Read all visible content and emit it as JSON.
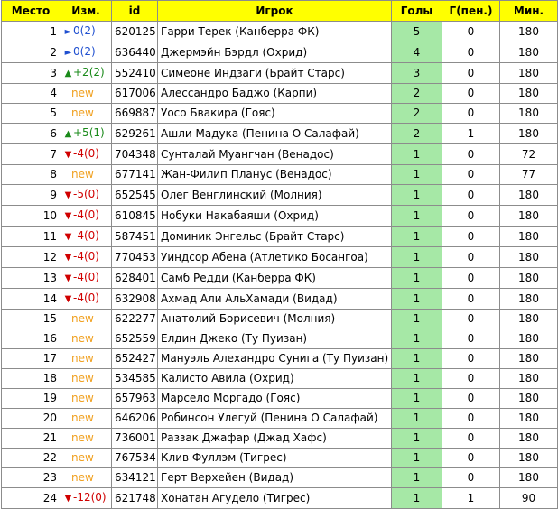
{
  "headers": {
    "place": "Место",
    "change": "Изм.",
    "id": "id",
    "player": "Игрок",
    "goals": "Голы",
    "pen": "Г(пен.)",
    "min": "Мин."
  },
  "colors": {
    "header_bg": "#ffff00",
    "goals_bg": "#a6e8a6",
    "new": "#f0a020",
    "up": "#1a8a1a",
    "down": "#d00000",
    "same": "#1f4fd0"
  },
  "rows": [
    {
      "place": "1",
      "change_type": "same",
      "arrow": "►",
      "change": "0(2)",
      "id": "620125",
      "player": "Гарри Терек (Канберра ФК)",
      "goals": "5",
      "pen": "0",
      "min": "180"
    },
    {
      "place": "2",
      "change_type": "same",
      "arrow": "►",
      "change": "0(2)",
      "id": "636440",
      "player": "Джермэйн Бэрдл (Охрид)",
      "goals": "4",
      "pen": "0",
      "min": "180"
    },
    {
      "place": "3",
      "change_type": "up",
      "arrow": "▲",
      "change": "+2(2)",
      "id": "552410",
      "player": "Симеоне Индзаги (Брайт Старс)",
      "goals": "3",
      "pen": "0",
      "min": "180"
    },
    {
      "place": "4",
      "change_type": "new",
      "arrow": "",
      "change": "new",
      "id": "617006",
      "player": "Алессандро Баджо (Карпи)",
      "goals": "2",
      "pen": "0",
      "min": "180"
    },
    {
      "place": "5",
      "change_type": "new",
      "arrow": "",
      "change": "new",
      "id": "669887",
      "player": "Уосо Бвакира (Гояс)",
      "goals": "2",
      "pen": "0",
      "min": "180"
    },
    {
      "place": "6",
      "change_type": "up",
      "arrow": "▲",
      "change": "+5(1)",
      "id": "629261",
      "player": "Ашли Мадука (Пенина О Салафай)",
      "goals": "2",
      "pen": "1",
      "min": "180"
    },
    {
      "place": "7",
      "change_type": "down",
      "arrow": "▼",
      "change": "-4(0)",
      "id": "704348",
      "player": "Сунталай Муангчан (Венадос)",
      "goals": "1",
      "pen": "0",
      "min": "72"
    },
    {
      "place": "8",
      "change_type": "new",
      "arrow": "",
      "change": "new",
      "id": "677141",
      "player": "Жан-Филип Планус (Венадос)",
      "goals": "1",
      "pen": "0",
      "min": "77"
    },
    {
      "place": "9",
      "change_type": "down",
      "arrow": "▼",
      "change": "-5(0)",
      "id": "652545",
      "player": "Олег Венглинский (Молния)",
      "goals": "1",
      "pen": "0",
      "min": "180"
    },
    {
      "place": "10",
      "change_type": "down",
      "arrow": "▼",
      "change": "-4(0)",
      "id": "610845",
      "player": "Нобуки Накабаяши (Охрид)",
      "goals": "1",
      "pen": "0",
      "min": "180"
    },
    {
      "place": "11",
      "change_type": "down",
      "arrow": "▼",
      "change": "-4(0)",
      "id": "587451",
      "player": "Доминик Энгельс (Брайт Старс)",
      "goals": "1",
      "pen": "0",
      "min": "180"
    },
    {
      "place": "12",
      "change_type": "down",
      "arrow": "▼",
      "change": "-4(0)",
      "id": "770453",
      "player": "Уиндсор Абена (Атлетико Босангоа)",
      "goals": "1",
      "pen": "0",
      "min": "180"
    },
    {
      "place": "13",
      "change_type": "down",
      "arrow": "▼",
      "change": "-4(0)",
      "id": "628401",
      "player": "Самб Редди (Канберра ФК)",
      "goals": "1",
      "pen": "0",
      "min": "180"
    },
    {
      "place": "14",
      "change_type": "down",
      "arrow": "▼",
      "change": "-4(0)",
      "id": "632908",
      "player": "Ахмад Али АльХамади (Видад)",
      "goals": "1",
      "pen": "0",
      "min": "180"
    },
    {
      "place": "15",
      "change_type": "new",
      "arrow": "",
      "change": "new",
      "id": "622277",
      "player": "Анатолий Борисевич (Молния)",
      "goals": "1",
      "pen": "0",
      "min": "180"
    },
    {
      "place": "16",
      "change_type": "new",
      "arrow": "",
      "change": "new",
      "id": "652559",
      "player": "Елдин Джеко (Ту Пуизан)",
      "goals": "1",
      "pen": "0",
      "min": "180"
    },
    {
      "place": "17",
      "change_type": "new",
      "arrow": "",
      "change": "new",
      "id": "652427",
      "player": "Мануэль Алехандро Сунига (Ту Пуизан)",
      "goals": "1",
      "pen": "0",
      "min": "180"
    },
    {
      "place": "18",
      "change_type": "new",
      "arrow": "",
      "change": "new",
      "id": "534585",
      "player": "Калисто Авила (Охрид)",
      "goals": "1",
      "pen": "0",
      "min": "180"
    },
    {
      "place": "19",
      "change_type": "new",
      "arrow": "",
      "change": "new",
      "id": "657963",
      "player": "Марсело Моргадо (Гояс)",
      "goals": "1",
      "pen": "0",
      "min": "180"
    },
    {
      "place": "20",
      "change_type": "new",
      "arrow": "",
      "change": "new",
      "id": "646206",
      "player": "Робинсон Улегуй (Пенина О Салафай)",
      "goals": "1",
      "pen": "0",
      "min": "180"
    },
    {
      "place": "21",
      "change_type": "new",
      "arrow": "",
      "change": "new",
      "id": "736001",
      "player": "Раззак Джафар (Джад Хафс)",
      "goals": "1",
      "pen": "0",
      "min": "180"
    },
    {
      "place": "22",
      "change_type": "new",
      "arrow": "",
      "change": "new",
      "id": "767534",
      "player": "Клив Фуллэм (Тигрес)",
      "goals": "1",
      "pen": "0",
      "min": "180"
    },
    {
      "place": "23",
      "change_type": "new",
      "arrow": "",
      "change": "new",
      "id": "634121",
      "player": "Герт Верхейен (Видад)",
      "goals": "1",
      "pen": "0",
      "min": "180"
    },
    {
      "place": "24",
      "change_type": "down",
      "arrow": "▼",
      "change": "-12(0)",
      "id": "621748",
      "player": "Хонатан Агудело (Тигрес)",
      "goals": "1",
      "pen": "1",
      "min": "90"
    }
  ]
}
